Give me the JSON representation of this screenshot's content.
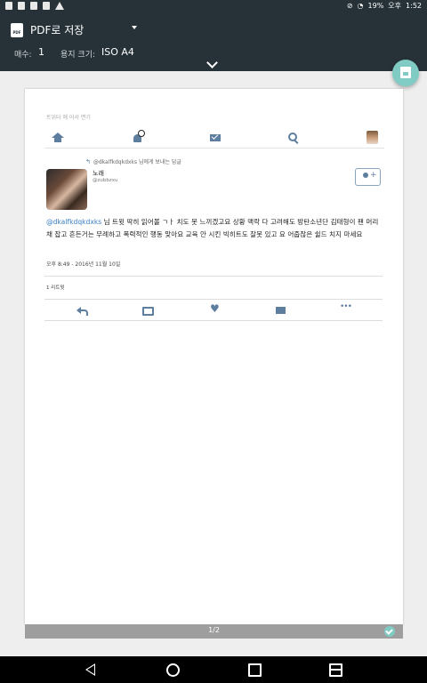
{
  "status_bar": {
    "battery": "19%",
    "carrier": "오후",
    "time": "1:52"
  },
  "print_header": {
    "destination": "PDF로 저장",
    "copies_label": "매수:",
    "copies_value": "1",
    "paper_label": "용지 크기:",
    "paper_value": "ISO A4"
  },
  "preview": {
    "page_title": "트위터 에 어서 면기",
    "reply_context": "@dkalfkdqkdxks 님에게 보내는 답글",
    "display_name": "노래",
    "handle": "@zubbzxu",
    "tweet_mention": "@dkalfkdqkdxks",
    "tweet_body": " 님 트윗 딱히 읽어볼 ㄱㅏ 치도 못 느끼겠고요 상황 맥락 다 고려해도 방탄소년단 김태형이 팬 머리채 잡고 흔든거는 무례하고 폭력적인 행동 맞아요 교육 안 시킨 빅히트도 잘못 있고 요 어줍잖은 쉴드 치지 마세요",
    "timestamp": "오후 8:49 - 2016년 11월 10일",
    "retweets": "1 리트윗"
  },
  "page_indicator": "1/2",
  "colors": {
    "header_bg": "#263238",
    "accent": "#80cbc4",
    "icon": "#5e7ea0",
    "link": "#3b7fc4"
  }
}
